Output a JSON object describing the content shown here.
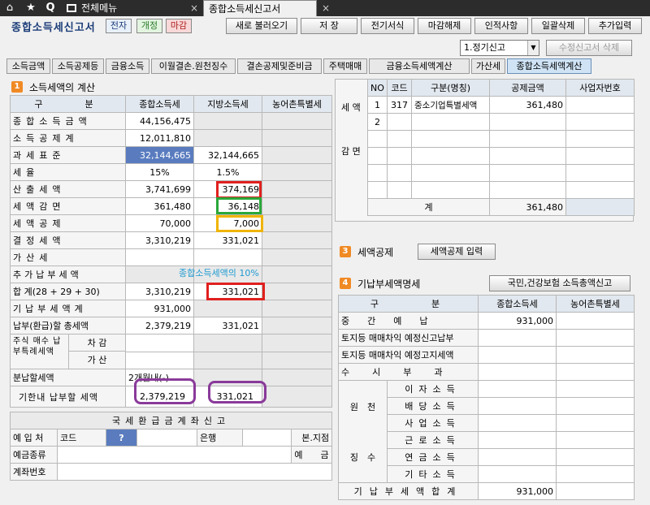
{
  "nav": {
    "menu_tab": "전체메뉴",
    "active_tab": "종합소득세신고서",
    "close_glyph": "×"
  },
  "header": {
    "title": "종합소득세신고서",
    "badges": [
      "전자",
      "개정",
      "마감"
    ],
    "buttons": [
      "새로 불러오기",
      "저 장",
      "전기서식",
      "마감해제",
      "인적사항",
      "일괄삭제",
      "추가입력"
    ],
    "select_value": "1.정기신고",
    "delete_button": "수정신고서 삭제"
  },
  "subtabs": [
    "소득금액",
    "소득공제등",
    "금융소득",
    "이월결손.원천징수",
    "결손공제및준비금",
    "주택매매",
    "금융소득세액계산",
    "가산세",
    "종합소득세액계산"
  ],
  "section1": {
    "num": "1",
    "title": "소득세액의 계산",
    "headers": [
      "구　　분",
      "종합소득세",
      "지방소득세",
      "농어촌특별세"
    ],
    "rows": [
      {
        "label": "종합소득금액",
        "v1": "44,156,475",
        "v2": "",
        "v3": ""
      },
      {
        "label": "소득공제계",
        "v1": "12,011,810",
        "v2": "",
        "v3": ""
      },
      {
        "label": "과세표준",
        "v1": "32,144,665",
        "v2": "32,144,665",
        "v3": ""
      },
      {
        "label": "세율",
        "v1": "15%",
        "v2": "1.5%",
        "v3": ""
      },
      {
        "label": "산출세액",
        "v1": "3,741,699",
        "v2": "374,169",
        "v3": ""
      },
      {
        "label": "세액감면",
        "v1": "361,480",
        "v2": "36,148",
        "v3": ""
      },
      {
        "label": "세액공제",
        "v1": "70,000",
        "v2": "7,000",
        "v3": ""
      },
      {
        "label": "결정세액",
        "v1": "3,310,219",
        "v2": "331,021",
        "v3": ""
      },
      {
        "label": "가산세",
        "v1": "",
        "v2": "",
        "v3": ""
      },
      {
        "label": "추가납부세액",
        "v1": "",
        "v2": "",
        "v3": ""
      },
      {
        "label": "합 계(28 + 29 + 30)",
        "v1": "3,310,219",
        "v2": "331,021",
        "v3": ""
      },
      {
        "label": "기납부세액계",
        "v1": "931,000",
        "v2": "",
        "v3": ""
      },
      {
        "label": "납부(환급)할 총세액",
        "v1": "2,379,219",
        "v2": "331,021",
        "v3": ""
      }
    ],
    "stock_label": "주식 매수 납부특례세액",
    "stock_sub": [
      "차 감",
      "가 산"
    ],
    "installment_label": "분납할세액",
    "installment_value": "2개월내(-)",
    "due_label": "기한내 납부할 세액",
    "due_v1": "2,379,219",
    "due_v2": "331,021",
    "note": "종합소득세액의 10%"
  },
  "refund": {
    "title": "국세환급금계좌신고",
    "bank_label": "예 입 처",
    "code_label": "코드",
    "help": "?",
    "bank": "은행",
    "branch": "본.지점",
    "type_label": "예금종류",
    "deposit": "예　　금",
    "account_label": "계좌번호"
  },
  "section2": {
    "num": "2",
    "side_label_top": "세 액",
    "side_label_bottom": "감 면",
    "headers": [
      "NO",
      "코드",
      "구분(명칭)",
      "공제금액",
      "사업자번호"
    ],
    "rows": [
      {
        "no": "1",
        "code": "317",
        "name": "중소기업특별세액",
        "amount": "361,480",
        "biz": ""
      },
      {
        "no": "2",
        "code": "",
        "name": "",
        "amount": "",
        "biz": ""
      }
    ],
    "total_label": "계",
    "total_amount": "361,480"
  },
  "section3": {
    "num": "3",
    "title": "세액공제",
    "button": "세액공제 입력"
  },
  "section4": {
    "num": "4",
    "title": "기납부세액명세",
    "button": "국민,건강보험 소득총액신고",
    "headers": [
      "구　　　분",
      "종합소득세",
      "농어촌특별세"
    ],
    "interim": {
      "label": "중간예납",
      "value": "931,000"
    },
    "land1": "토지등 매매차익 예정신고납부",
    "land2": "토지등 매매차익 예정고지세액",
    "occasional": "수시부과",
    "wh_label_top": "원　천",
    "wh_label_bottom": "징　수",
    "withholding": [
      "이자소득",
      "배당소득",
      "사업소득",
      "근로소득",
      "연금소득",
      "기타소득"
    ],
    "total_label": "기납부세액합계",
    "total_value": "931,000"
  },
  "colors": {
    "red_box": "#e0201e",
    "green_box": "#2aa83a",
    "yellow_box": "#f0b400",
    "purple_box": "#8a3a9a",
    "highlight_cell": "#5a7cbf",
    "note_text": "#1e9ad0",
    "section_num": "#f08a24"
  }
}
